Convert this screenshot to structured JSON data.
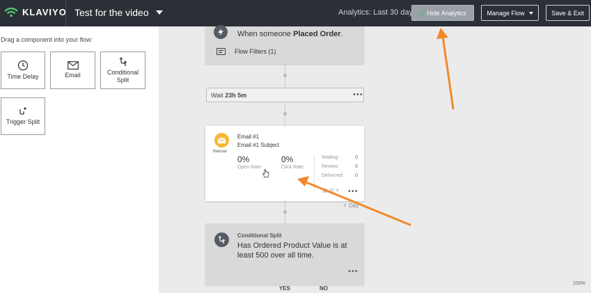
{
  "header": {
    "logo_text": "KLAVIYO",
    "flow_title": "Test for the video",
    "analytics_range": "Analytics: Last 30 days",
    "hide_analytics_label": "Hide Analytics",
    "manage_flow_label": "Manage Flow",
    "save_exit_label": "Save & Exit"
  },
  "sidebar": {
    "title": "Drag a component into your flow:",
    "components": [
      {
        "label": "Time Delay",
        "icon": "clock-icon"
      },
      {
        "label": "Email",
        "icon": "envelope-icon"
      },
      {
        "label": "Conditional Split",
        "icon": "split-icon"
      },
      {
        "label": "Trigger Split",
        "icon": "trigger-split-icon"
      }
    ]
  },
  "flow": {
    "trigger": {
      "prefix": "When someone",
      "event": "Placed Order",
      "suffix": ".",
      "filters": "Flow Filters (1)"
    },
    "wait": {
      "prefix": "Wait",
      "duration": "23h 5m"
    },
    "email": {
      "name": "Email #1",
      "subject": "Email #1 Subject",
      "mode": "Manual",
      "open_rate_value": "0%",
      "open_rate_label": "Open Rate",
      "click_rate_value": "0%",
      "click_rate_label": "Click Rate",
      "waiting_label": "Waiting:",
      "waiting_value": "0",
      "review_label": "Review:",
      "review_value": "0",
      "delivered_label": "Delivered:",
      "delivered_value": "0",
      "delay_tag": "Day"
    },
    "split": {
      "title": "Conditional Split",
      "description": "Has Ordered Product Value is at least 500 over all time.",
      "yes_label": "YES",
      "no_label": "NO"
    }
  },
  "canvas": {
    "zoom": "100%"
  },
  "colors": {
    "topbar": "#2b2f36",
    "annotation_arrow": "#f0892a",
    "email_icon": "#f5b833",
    "analytics_icon": "#4cc36b"
  }
}
